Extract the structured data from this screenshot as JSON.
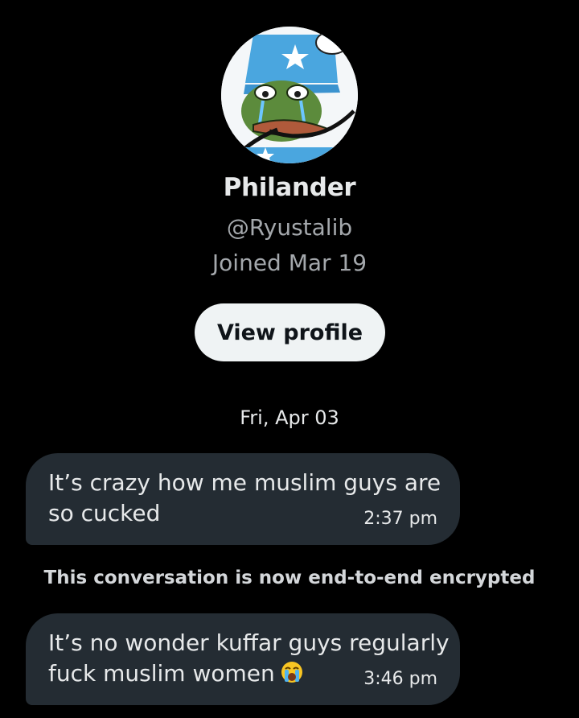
{
  "profile": {
    "name": "Philander",
    "handle": "@Ryustalib",
    "joined": "Joined Mar 19",
    "view_profile_label": "View profile"
  },
  "conversation": {
    "date_separator": "Fri, Apr 03",
    "encryption_notice": "This conversation is now end-to-end encrypted",
    "messages": [
      {
        "text": "It’s crazy how me muslim guys are so cucked",
        "time": "2:37 pm"
      },
      {
        "text": "It’s no wonder kuffar guys regularly fuck muslim women",
        "emoji": "loudly-crying-face-icon",
        "time": "3:46 pm"
      }
    ]
  },
  "colors": {
    "background": "#000000",
    "bubble": "#242c33",
    "button": "#eff3f4",
    "secondary_text": "#a4a8ac"
  }
}
